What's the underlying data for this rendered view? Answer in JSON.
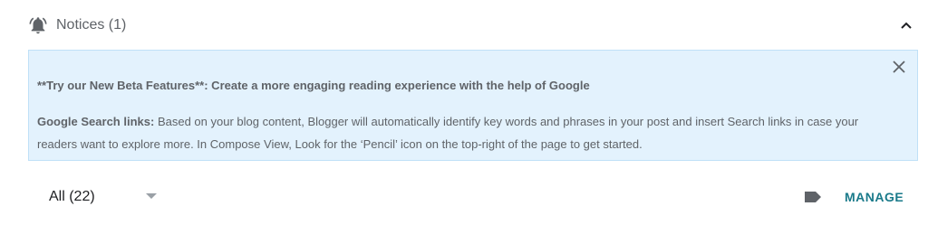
{
  "notices": {
    "title": "Notices (1)",
    "icon": "bell-icon",
    "collapse_icon": "chevron-up-icon"
  },
  "notice": {
    "headline": "**Try our New Beta Features**: Create a more engaging reading experience with the help of Google",
    "body_label": "Google Search links:",
    "body_text": " Based on your blog content, Blogger will automatically identify key words and phrases in your post and insert Search links in case your readers want to explore more. In Compose View, Look for the ‘Pencil’ icon on the top-right of the page to get started.",
    "close_icon": "close-icon",
    "background_color": "#e3f2fd"
  },
  "filter": {
    "selected": "All (22)",
    "arrow_icon": "dropdown-arrow-icon"
  },
  "actions": {
    "label_icon": "label-icon",
    "manage_label": "MANAGE",
    "manage_color": "#1a7a8a"
  }
}
